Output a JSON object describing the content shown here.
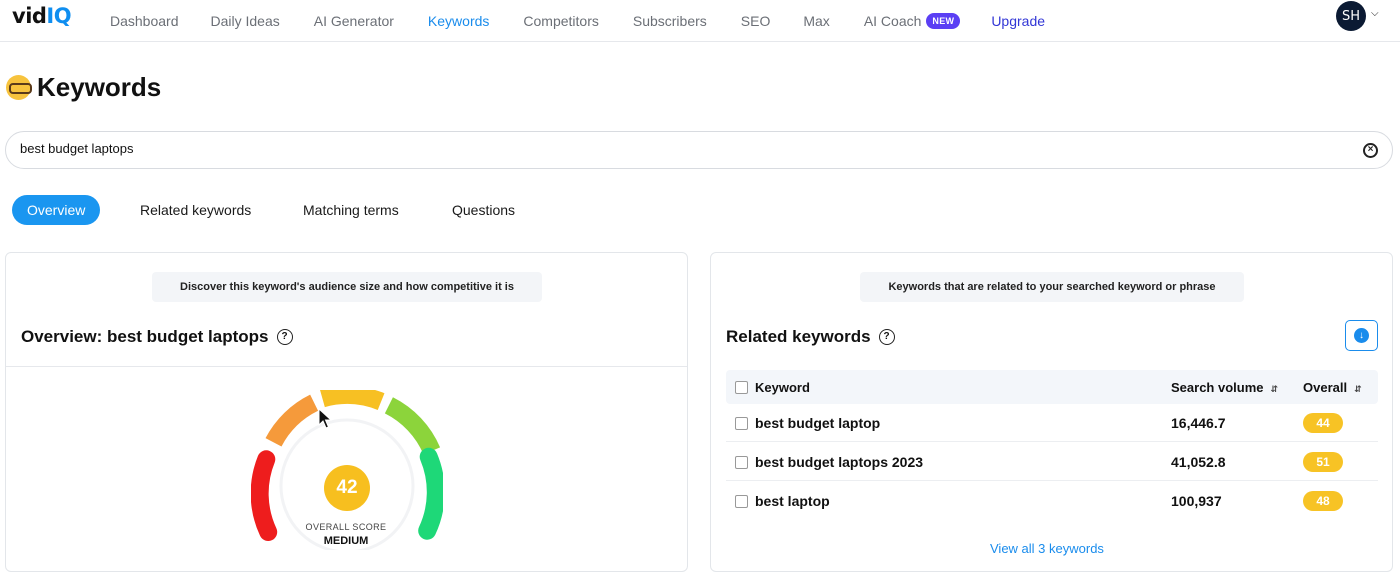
{
  "nav": {
    "logo_main": "vid",
    "logo_accent": "IQ",
    "items": [
      {
        "label": "Dashboard"
      },
      {
        "label": "Daily Ideas"
      },
      {
        "label": "AI Generator"
      },
      {
        "label": "Keywords"
      },
      {
        "label": "Competitors"
      },
      {
        "label": "Subscribers"
      },
      {
        "label": "SEO"
      },
      {
        "label": "Max"
      },
      {
        "label": "AI Coach",
        "badge": "NEW"
      },
      {
        "label": "Upgrade"
      }
    ],
    "active": "Keywords",
    "avatar_initials": "SH",
    "accent_color": "#1a8cec",
    "badge_color": "#5b3ff4"
  },
  "page": {
    "title": "Keywords",
    "title_icon": "nerd-face-emoji"
  },
  "search": {
    "value": "best budget laptops"
  },
  "tabs": [
    {
      "label": "Overview",
      "active": true
    },
    {
      "label": "Related keywords"
    },
    {
      "label": "Matching terms"
    },
    {
      "label": "Questions"
    }
  ],
  "overview": {
    "hint": "Discover this keyword's audience size and how competitive it is",
    "title": "Overview: best budget laptops",
    "score": "42",
    "score_label": "OVERALL SCORE",
    "score_level": "MEDIUM",
    "score_fraction": 0.42
  },
  "related": {
    "hint": "Keywords that are related to your searched keyword or phrase",
    "title": "Related keywords",
    "columns": {
      "keyword": "Keyword",
      "volume": "Search volume",
      "overall": "Overall"
    },
    "rows": [
      {
        "keyword": "best budget laptop",
        "volume": "16,446.7",
        "overall": "44"
      },
      {
        "keyword": "best budget laptops 2023",
        "volume": "41,052.8",
        "overall": "51"
      },
      {
        "keyword": "best laptop",
        "volume": "100,937",
        "overall": "48"
      }
    ],
    "view_all": "View all 3 keywords"
  }
}
